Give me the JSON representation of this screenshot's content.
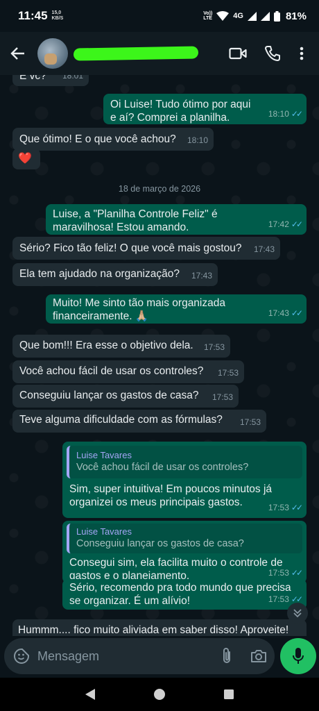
{
  "status_bar": {
    "time": "11:45",
    "speed_value": "15,0",
    "speed_unit": "KB/S",
    "volte_top": "Vo))",
    "volte_bottom": "LTE",
    "network": "4G",
    "battery": "81%"
  },
  "header": {
    "contact_name": "",
    "actions": [
      "video-call",
      "voice-call",
      "more-options"
    ]
  },
  "chat": {
    "date_separator": "18 de março de 2026",
    "messages": [
      {
        "dir": "in",
        "text": "E vc?",
        "time": "18:01"
      },
      {
        "dir": "out",
        "text": "Oi Luise! Tudo ótimo por aqui e aí? Comprei a planilha.",
        "time": "18:10"
      },
      {
        "dir": "in",
        "text": "Que ótimo! E o que você achou?",
        "time": "18:10"
      },
      {
        "dir": "in",
        "text": "❤️",
        "time": ""
      },
      {
        "dir": "out",
        "text": "Luise, a \"Planilha Controle Feliz\" é maravilhosa! Estou amando.",
        "time": "17:42"
      },
      {
        "dir": "in",
        "text": "Sério? Fico tão feliz! O que você mais gostou?",
        "time": "17:43"
      },
      {
        "dir": "in",
        "text": "Ela tem ajudado na organização?",
        "time": "17:43"
      },
      {
        "dir": "out",
        "text": "Muito! Me sinto tão mais organizada financeiramente. 🙏🏼",
        "time": "17:43"
      },
      {
        "dir": "in",
        "text": "Que bom!!! Era esse o objetivo dela.",
        "time": "17:53"
      },
      {
        "dir": "in",
        "text": "Você achou fácil de usar os controles?",
        "time": "17:53"
      },
      {
        "dir": "in",
        "text": "Conseguiu lançar os gastos de casa?",
        "time": "17:53"
      },
      {
        "dir": "in",
        "text": "Teve alguma dificuldade com as fórmulas?",
        "time": "17:53"
      },
      {
        "dir": "out",
        "quote_name": "Luise Tavares",
        "quote_text": "Você achou fácil de usar os controles?",
        "text": "Sim, super intuitiva! Em poucos minutos já organizei os meus principais gastos.",
        "time": "17:53"
      },
      {
        "dir": "out",
        "quote_name": "Luise Tavares",
        "quote_text": "Conseguiu lançar os gastos de casa?",
        "text": "Consegui sim, ela facilita muito o controle de gastos e o planejamento.",
        "time": "17:53"
      },
      {
        "dir": "out",
        "text": "Sério, recomendo pra todo mundo que precisa se organizar. É um alívio!",
        "time": "17:53"
      },
      {
        "dir": "in",
        "text": "Hummm.... fico muito aliviada em saber disso! Aproveite!",
        "time": ""
      }
    ]
  },
  "composer": {
    "placeholder": "Mensagem"
  },
  "colors": {
    "incoming_bubble": "#202c33",
    "outgoing_bubble": "#005c4b",
    "read_ticks": "#53bdeb",
    "mic_button": "#21c063",
    "quote_name": "#a5a6f6"
  }
}
